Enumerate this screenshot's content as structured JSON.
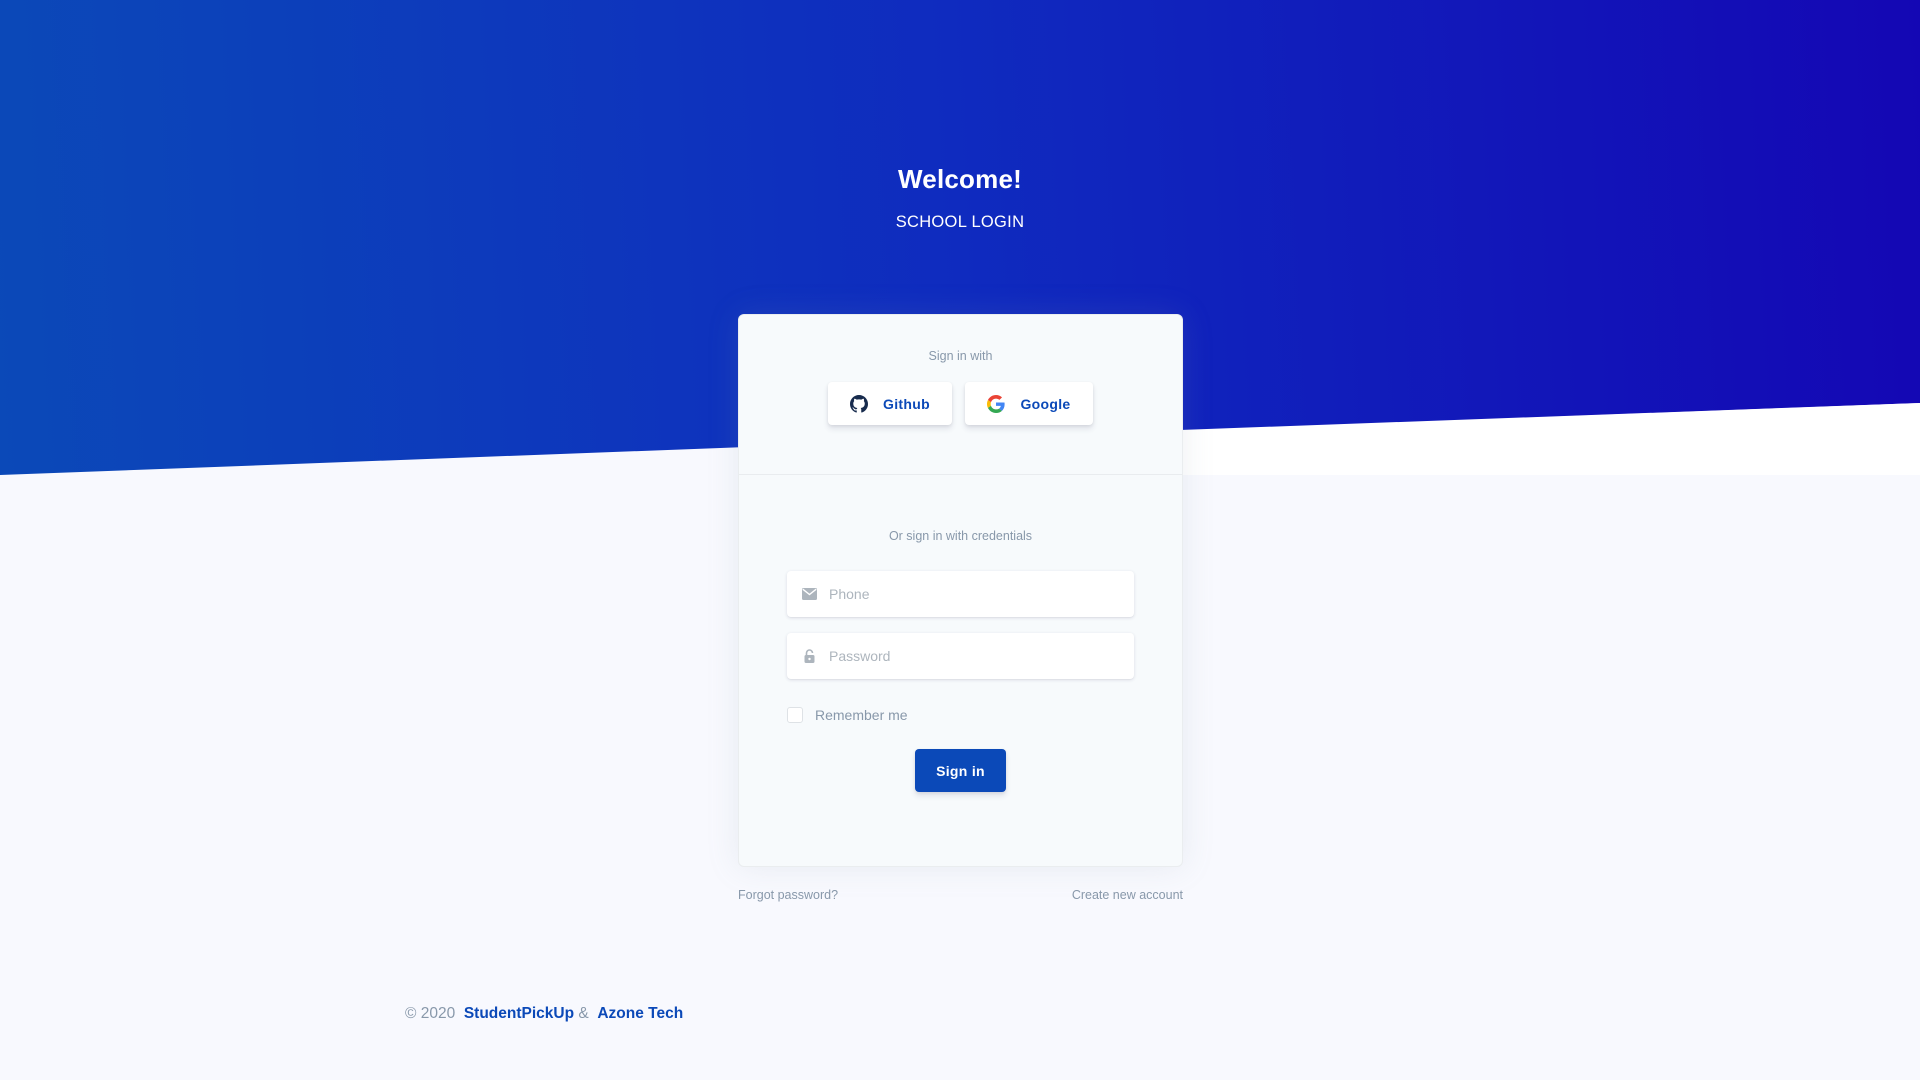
{
  "header": {
    "title": "Welcome!",
    "subtitle": "SCHOOL LOGIN"
  },
  "social": {
    "caption": "Sign in with",
    "github_label": "Github",
    "google_label": "Google"
  },
  "credentials": {
    "caption": "Or sign in with credentials",
    "phone_placeholder": "Phone",
    "password_placeholder": "Password",
    "remember_label": "Remember me",
    "signin_label": "Sign in"
  },
  "links": {
    "forgot": "Forgot password?",
    "create": "Create new account"
  },
  "footer": {
    "copyright": "© 2020",
    "brand1": "StudentPickUp",
    "separator": "&",
    "brand2": "Azone Tech"
  },
  "colors": {
    "primary": "#0b49b8",
    "hero_gradient_end": "#1407b4",
    "muted": "#8898aa"
  },
  "icons": {
    "phone": "envelope-icon",
    "password": "lock-icon"
  }
}
